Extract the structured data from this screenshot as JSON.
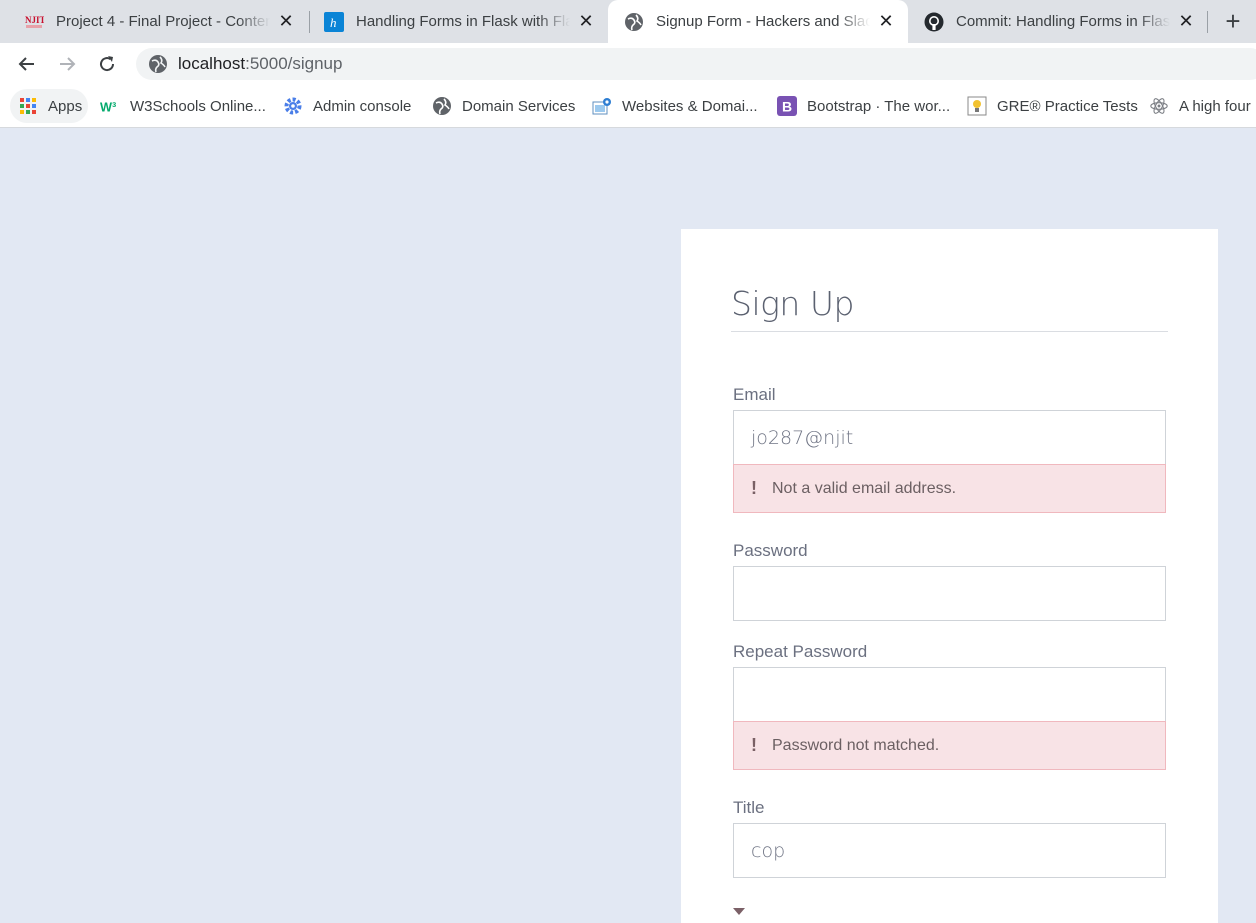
{
  "browser": {
    "tabs": [
      {
        "title": "Project 4 - Final Project - Content",
        "favicon": "njit-logo-icon",
        "active": false
      },
      {
        "title": "Handling Forms in Flask with Flask",
        "favicon": "hackers-h-icon",
        "active": false
      },
      {
        "title": "Signup Form - Hackers and Slackers",
        "favicon": "globe-icon",
        "active": true
      },
      {
        "title": "Commit: Handling Forms in Flask",
        "favicon": "github-icon",
        "active": false
      }
    ],
    "tab_icon_text": {
      "njit": "NJIT",
      "hackers": "h"
    },
    "new_tab_label": "+",
    "address": {
      "host": "localhost",
      "path": ":5000/signup"
    },
    "bookmarks": [
      {
        "label": "Apps",
        "icon": "apps-grid-icon"
      },
      {
        "label": "W3Schools Online...",
        "icon": "w3schools-icon"
      },
      {
        "label": "Admin console",
        "icon": "admin-gear-icon"
      },
      {
        "label": "Domain Services",
        "icon": "globe-icon"
      },
      {
        "label": "Websites & Domai...",
        "icon": "websites-icon"
      },
      {
        "label": "Bootstrap · The wor...",
        "icon": "bootstrap-icon"
      },
      {
        "label": "GRE® Practice Tests",
        "icon": "gre-icon"
      },
      {
        "label": "A high four",
        "icon": "react-atom-icon"
      }
    ],
    "bookmark_icon_text": {
      "w3": "W³",
      "bootstrap": "B"
    }
  },
  "form": {
    "title": "Sign Up",
    "email": {
      "label": "Email",
      "value": "jo287@njit",
      "error": "Not a valid email address."
    },
    "password": {
      "label": "Password",
      "value": ""
    },
    "repeat_password": {
      "label": "Repeat Password",
      "value": "",
      "error": "Password not matched."
    },
    "title_field": {
      "label": "Title",
      "value": "cop"
    },
    "error_mark": "!"
  },
  "colors": {
    "page_bg": "#e2e8f3",
    "card_bg": "#ffffff",
    "error_bg": "#f8e3e6",
    "error_border": "#f0b8be"
  }
}
